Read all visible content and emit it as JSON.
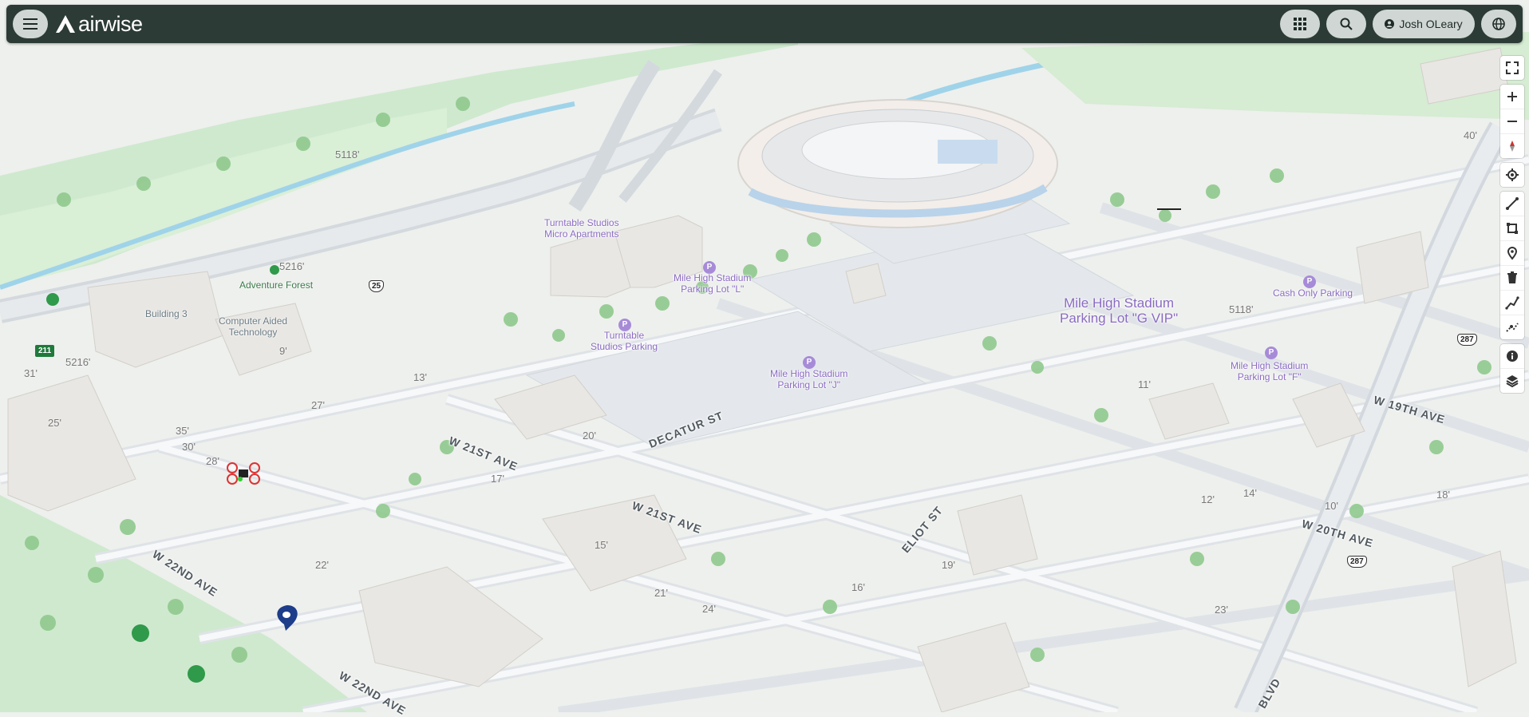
{
  "app": {
    "brand": "airwise"
  },
  "header": {
    "user_name": "Josh OLeary"
  },
  "icons": {
    "menu": "hamburger-menu-icon",
    "apps": "grid-apps-icon",
    "search": "search-icon",
    "user": "user-icon",
    "language": "globe-icon"
  },
  "colors": {
    "header_bg": "#2c3b36",
    "button_bg": "#cfd6d4",
    "poi": "#8a6bc2",
    "park": "#cfe9cf"
  },
  "toolbar": [
    "fullscreen-icon",
    "zoom-in-icon",
    "zoom-out-icon",
    "compass-icon",
    "locate-icon",
    "measure-line-icon",
    "measure-area-icon",
    "place-marker-icon",
    "delete-icon",
    "draw-path-icon",
    "edit-path-icon",
    "info-icon",
    "layers-icon"
  ],
  "map": {
    "streets": {
      "w21": "W 21ST AVE",
      "w21b": "W 21ST AVE",
      "w22": "W 22ND AVE",
      "w22b": "W 22ND AVE",
      "decatur": "DECATUR ST",
      "eliot": "ELIOT ST",
      "w19": "W 19TH AVE",
      "w20": "W 20TH AVE",
      "blvd": "BLVD"
    },
    "pois": {
      "turntable_apts": "Turntable Studios\nMicro Apartments",
      "lot_l": "Mile High Stadium\nParking Lot \"L\"",
      "turntable_parking": "Turntable\nStudios Parking",
      "lot_j": "Mile High Stadium\nParking Lot \"J\"",
      "lot_gvip": "Mile High Stadium\nParking Lot \"G VIP\"",
      "cash_only": "Cash Only Parking",
      "lot_f": "Mile High Stadium\nParking Lot \"F\""
    },
    "areas": {
      "building3": "Building 3",
      "cat": "Computer Aided\nTechnology",
      "adventure": "Adventure Forest"
    },
    "shields": {
      "i25": "25",
      "us287a": "287",
      "us287b": "287",
      "r211": "211",
      "r5216a": "5216'",
      "r5118": "5118'"
    },
    "heights": [
      "9'",
      "13'",
      "15'",
      "17'",
      "20'",
      "21'",
      "22'",
      "24'",
      "25'",
      "28'",
      "30'",
      "31'",
      "35'",
      "12'",
      "14'",
      "16'",
      "18'",
      "19'",
      "10'",
      "11'",
      "23'",
      "27'",
      "40'",
      "5216'",
      "5118'"
    ]
  }
}
